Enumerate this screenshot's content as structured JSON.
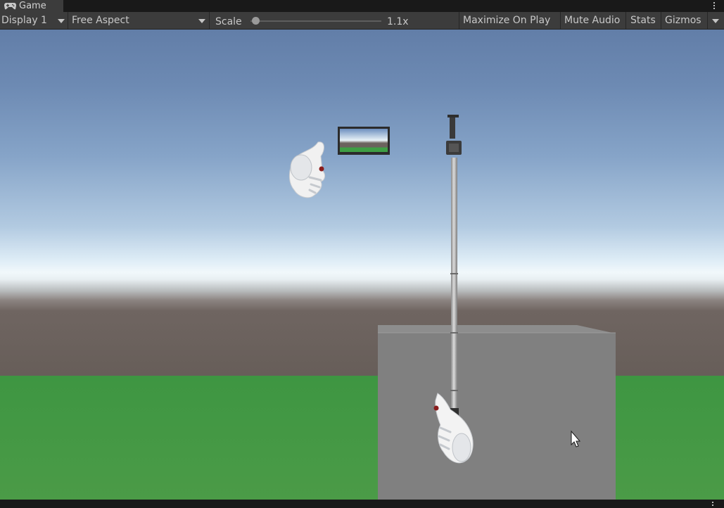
{
  "tab": {
    "title": "Game",
    "icon": "gamepad-icon"
  },
  "toolbar": {
    "display": "Display 1",
    "aspect": "Free Aspect",
    "scale_label": "Scale",
    "scale_value": "1.1x",
    "scale_fraction": 0.04,
    "maximize": "Maximize On Play",
    "mute": "Mute Audio",
    "stats": "Stats",
    "gizmos": "Gizmos"
  },
  "scene": {
    "objects": [
      "left-hand-model",
      "right-hand-model",
      "camera-preview-panel",
      "selfie-stick",
      "grey-cube",
      "mouse-cursor"
    ],
    "colors": {
      "sky_top": "#627ea8",
      "horizon": "#f1f8fb",
      "ground_far": "#675e59",
      "grass": "#3e9642",
      "cube": "#808080"
    }
  }
}
